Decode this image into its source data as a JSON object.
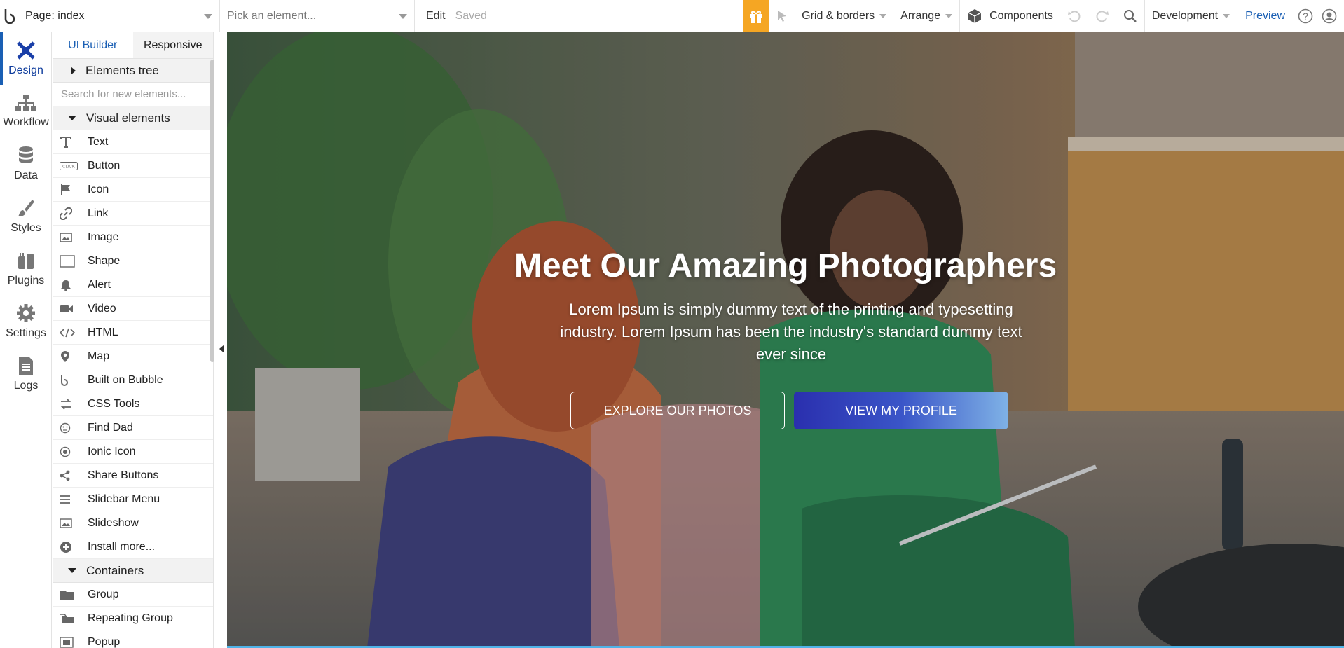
{
  "topbar": {
    "page_label": "Page: index",
    "element_placeholder": "Pick an element...",
    "edit": "Edit",
    "saved": "Saved",
    "grid": "Grid & borders",
    "arrange": "Arrange",
    "components": "Components",
    "environment": "Development",
    "preview": "Preview"
  },
  "rail": [
    {
      "label": "Design",
      "icon": "design-icon"
    },
    {
      "label": "Workflow",
      "icon": "workflow-icon"
    },
    {
      "label": "Data",
      "icon": "database-icon"
    },
    {
      "label": "Styles",
      "icon": "brush-icon"
    },
    {
      "label": "Plugins",
      "icon": "plug-icon"
    },
    {
      "label": "Settings",
      "icon": "gear-icon"
    },
    {
      "label": "Logs",
      "icon": "document-icon"
    }
  ],
  "panel": {
    "tab_ui_builder": "UI Builder",
    "tab_responsive": "Responsive",
    "elements_tree": "Elements tree",
    "search_placeholder": "Search for new elements...",
    "visual_elements": "Visual elements",
    "items": [
      "Text",
      "Button",
      "Icon",
      "Link",
      "Image",
      "Shape",
      "Alert",
      "Video",
      "HTML",
      "Map",
      "Built on Bubble",
      "CSS Tools",
      "Find Dad",
      "Ionic Icon",
      "Share Buttons",
      "Slidebar Menu",
      "Slideshow",
      "Install more..."
    ],
    "containers": "Containers",
    "container_items": [
      "Group",
      "Repeating Group",
      "Popup"
    ]
  },
  "hero": {
    "title": "Meet Our Amazing Photographers",
    "subtitle": "Lorem Ipsum is simply dummy text of the printing and typesetting industry. Lorem Ipsum has been the industry's standard dummy text ever since",
    "btn_explore": "EXPLORE OUR PHOTOS",
    "btn_profile": "VIEW MY PROFILE"
  },
  "colors": {
    "accent": "#1a5fb4",
    "gift": "#f5a623"
  }
}
